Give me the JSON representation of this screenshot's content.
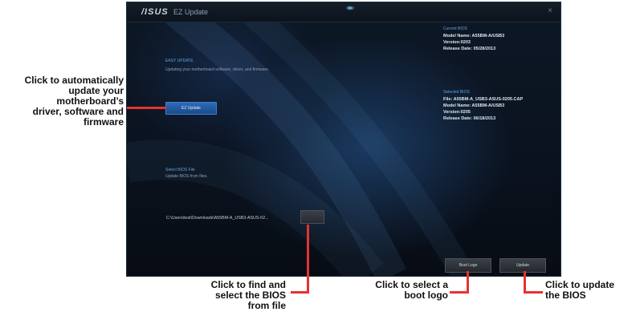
{
  "window": {
    "logo": "/ISUS",
    "title": "EZ Update",
    "close": "×"
  },
  "left": {
    "easy_update_title": "EASY UPDATE",
    "easy_update_desc": "Updating your motherboard software, driver, and firmware.",
    "ez_update_button": "EZ Update",
    "select_file_title": "Select BIOS File",
    "select_file_desc": "Update BIOS from files.",
    "file_path": "C:\\Users\\test\\Downloads\\A55BM-A_USB3-ASUS-02...",
    "browse_button": ""
  },
  "right": {
    "current_title": "Current BIOS",
    "current_model": "Model Name: A55BM-A/USB3",
    "current_version": "Version:0203",
    "current_date": "Release Date: 05/28/2013",
    "selected_title": "Selected BIOS",
    "selected_file": "File: A55BM-A_USB3-ASUS-0205.CAP",
    "selected_model": "Model Name: A55BM-A/USB3",
    "selected_version": "Version:0205",
    "selected_date": "Release Date: 06/18/2013"
  },
  "buttons": {
    "boot_logo": "Boot Logo",
    "update": "Update"
  },
  "callouts": {
    "auto_update": [
      "Click to automatically",
      "update your",
      "motherboard’s",
      "driver, software and",
      "firmware"
    ],
    "find_bios": [
      "Click to find and",
      "select the BIOS",
      "from file"
    ],
    "boot_logo": [
      "Click to select a",
      "boot logo"
    ],
    "update_bios": [
      "Click to update",
      "the BIOS"
    ]
  },
  "colors": {
    "callout_line": "#e53331",
    "accent_blue": "#2c6bb8",
    "section_title": "#5fa4e0"
  }
}
